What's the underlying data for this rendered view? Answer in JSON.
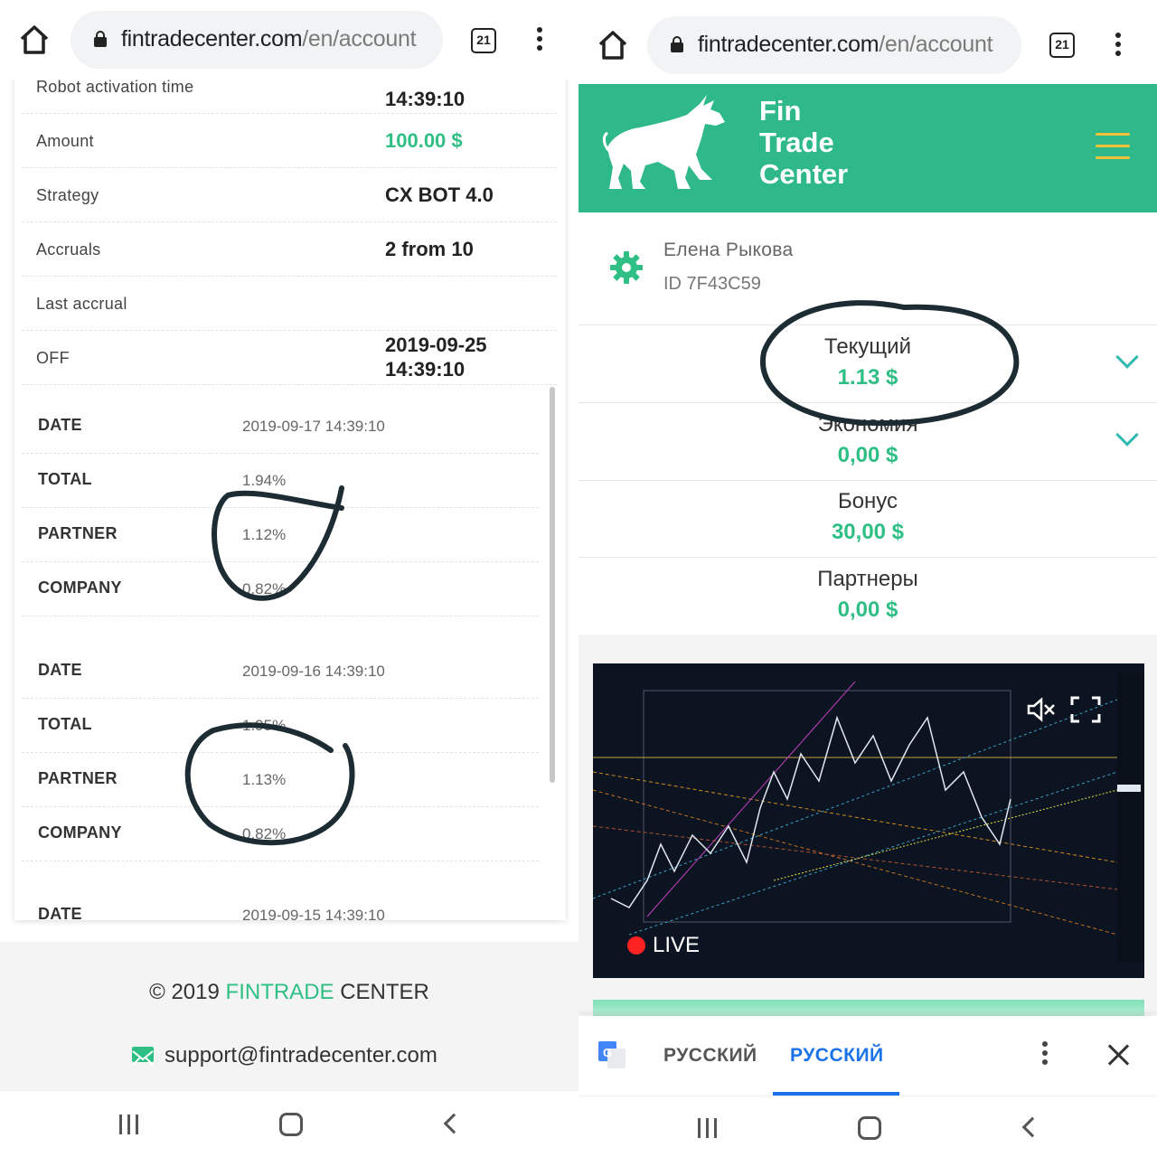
{
  "left": {
    "browser": {
      "domain": "fintradecenter.com",
      "path": "/en/account",
      "tab_count": "21"
    },
    "info_rows": [
      {
        "label": "Robot activation time",
        "value": "14:39:10"
      },
      {
        "label": "Amount",
        "value": "100.00 $"
      },
      {
        "label": "Strategy",
        "value": "CX BOT 4.0"
      },
      {
        "label": "Accruals",
        "value": "2 from 10"
      },
      {
        "label": "Last accrual",
        "value": ""
      },
      {
        "label": "OFF",
        "value_line1": "2019-09-25",
        "value_line2": "14:39:10"
      }
    ],
    "accrual_groups": [
      {
        "date_label": "DATE",
        "date": "2019-09-17 14:39:10",
        "total_label": "TOTAL",
        "total": "1.94%",
        "partner_label": "PARTNER",
        "partner": "1.12%",
        "company_label": "COMPANY",
        "company": "0.82%"
      },
      {
        "date_label": "DATE",
        "date": "2019-09-16 14:39:10",
        "total_label": "TOTAL",
        "total": "1.95%",
        "partner_label": "PARTNER",
        "partner": "1.13%",
        "company_label": "COMPANY",
        "company": "0.82%"
      },
      {
        "date_label": "DATE",
        "date": "2019-09-15 14:39:10"
      }
    ],
    "footer": {
      "copyright_prefix": "© 2019 ",
      "copyright_brand": "FINTRADE",
      "copyright_suffix": " CENTER",
      "email": "support@fintradecenter.com"
    }
  },
  "right": {
    "browser": {
      "domain": "fintradecenter.com",
      "path": "/en/account",
      "tab_count": "21"
    },
    "brand": {
      "line1": "Fin",
      "line2": "Trade",
      "line3": "Center"
    },
    "user": {
      "name": "Елена Рыкова",
      "id": "ID 7F43C59"
    },
    "balances": [
      {
        "label": "Текущий",
        "value": "1.13 $",
        "expandable": true
      },
      {
        "label": "Экономия",
        "value": "0,00 $",
        "expandable": true
      },
      {
        "label": "Бонус",
        "value": "30,00 $",
        "expandable": false
      },
      {
        "label": "Партнеры",
        "value": "0,00 $",
        "expandable": false
      }
    ],
    "video": {
      "live_label": "LIVE"
    },
    "translate": {
      "source_lang": "РУССКИЙ",
      "target_lang": "РУССКИЙ"
    }
  },
  "colors": {
    "accent_green": "#2fbf84",
    "header_green": "#2fb98a",
    "hamburger_yellow": "#f2c23a",
    "translate_blue": "#1a73e8",
    "ink": "#1d2b33"
  },
  "icons": [
    "home-icon",
    "lock-icon",
    "tabs-icon",
    "more-vert-icon",
    "hamburger-icon",
    "gear-icon",
    "chevron-down-icon",
    "mute-icon",
    "fullscreen-icon",
    "mail-icon",
    "google-translate-icon",
    "close-icon",
    "recent-apps-icon",
    "home-nav-icon",
    "back-icon"
  ]
}
